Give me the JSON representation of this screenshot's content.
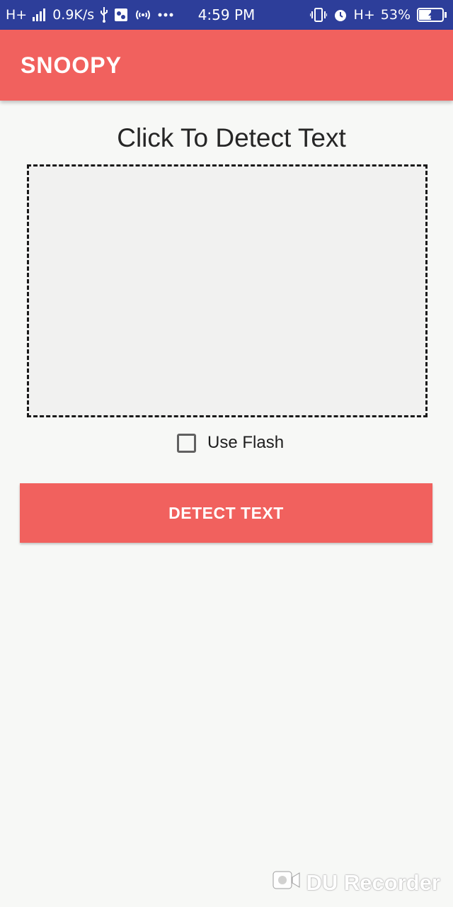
{
  "status_bar": {
    "network_left": "H+",
    "speed": "0.9K/s",
    "time": "4:59 PM",
    "network_right": "H+",
    "battery_percent": "53%",
    "battery_level": 0.53,
    "icons": [
      "signal-icon",
      "usb-icon",
      "notification-icon",
      "hotspot-icon",
      "more-dots-icon",
      "vibrate-icon",
      "alarm-icon",
      "battery-charging-icon"
    ]
  },
  "app_bar": {
    "title": "SNOOPY"
  },
  "main": {
    "heading": "Click To Detect Text",
    "use_flash_label": "Use Flash",
    "use_flash_checked": false,
    "detect_button_label": "DETECT TEXT"
  },
  "watermark": {
    "text": "DU Recorder"
  },
  "colors": {
    "status_bar": "#2d3e9a",
    "accent": "#f1615e",
    "background": "#f7f8f6"
  }
}
